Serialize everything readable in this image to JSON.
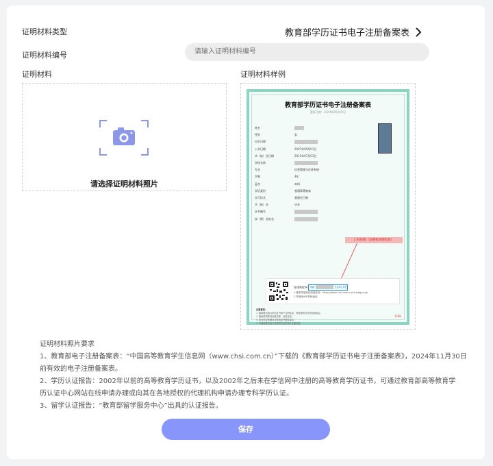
{
  "form": {
    "type_label": "证明材料类型",
    "type_value": "教育部学历证书电子注册备案表",
    "number_label": "证明材料编号",
    "number_placeholder": "请输入证明材料编号",
    "material_label": "证明材料",
    "sample_label": "证明材料样例",
    "upload_text": "请选择证明材料照片"
  },
  "sample_cert": {
    "title": "教育部学历证书电子注册备案表",
    "subtitle": "更新日期：2024年06月30日",
    "rows": [
      {
        "k": "姓名",
        "v": ""
      },
      {
        "k": "性别",
        "v": "女"
      },
      {
        "k": "出生日期",
        "v": ""
      },
      {
        "k": "入学日期",
        "v": "2007年09月01日"
      },
      {
        "k": "毕（结）业日期",
        "v": "2011年07月01日"
      },
      {
        "k": "学校名称",
        "v": ""
      },
      {
        "k": "专业",
        "v": "信息管理与信息系统"
      },
      {
        "k": "学制",
        "v": "4年"
      },
      {
        "k": "层次",
        "v": "本科"
      },
      {
        "k": "学历类别",
        "v": "普通高等教育"
      },
      {
        "k": "学习形式",
        "v": "普通全日制"
      },
      {
        "k": "毕（结）业",
        "v": "毕业"
      },
      {
        "k": "证书编号",
        "v": ""
      },
      {
        "k": "校（院）长姓名",
        "v": ""
      }
    ],
    "annotation": "2.有效期（注明有效期信息）",
    "verify_label": "在线验证码",
    "verify_code_start": "AW",
    "verify_code_end": "SXACAE",
    "verify_line1": "1.登录学信网在线验证码：https://www.chsi.com.cn/xlcx/bgcx.jsp",
    "verify_line2": "2.学信网APP扫码验证",
    "notes_title": "注意事项：",
    "notes": [
      "1. 备案表内容为学历证书电子注册信息，有效期内可在学信网验证。",
      "2. 备案表须保持完整清晰，涂改无效。",
      "3. 如对信息有疑问请咨询证书颁发单位。",
      "4. 本备案表仅用于证明学历证书电子注册信息。"
    ],
    "seal_text": "CHSI"
  },
  "requirements": {
    "title": "证明材料照片要求",
    "items": [
      "1、教育部电子注册备案表：“中国高等教育学生信息网（www.chsi.com.cn）”下载的《教育部学历证书电子注册备案表》，2024年11月30日",
      "前有效的电子注册备案表。",
      "2、学历认证报告：2002年以前的高等教育学历证书，以及2002年之后未在学信网中注册的高等教育学历证书，可通过教育部高等教育学",
      "历认证中心网站在线申请办理或向其在各地授权的代理机构申请办理专科学历认证。",
      "3、留学认证报告：“教育部留学服务中心”出具的认证报告。"
    ]
  },
  "save_label": "保存",
  "colors": {
    "accent": "#8896fb",
    "cert_border": "#8fd3c3",
    "code_blue": "#2b8fd9",
    "annot_red": "#d33"
  }
}
